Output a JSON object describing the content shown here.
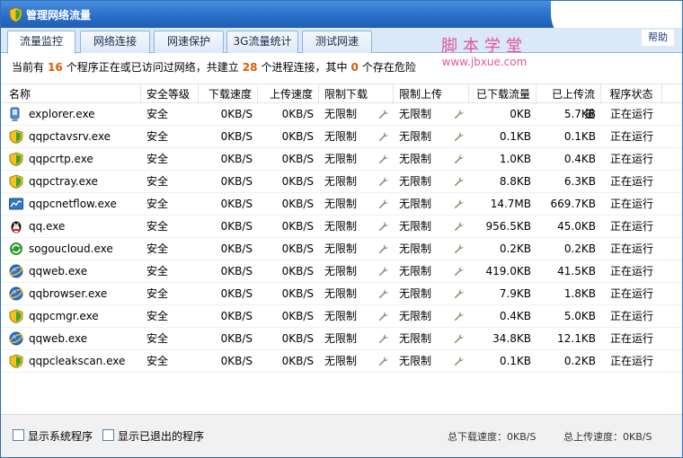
{
  "window": {
    "title": "管理网络流量"
  },
  "help_label": "帮助",
  "watermark": {
    "cn": "脚本学堂",
    "url": "www.jbxue.com"
  },
  "tabs": [
    {
      "label": "流量监控",
      "active": true
    },
    {
      "label": "网络连接",
      "active": false
    },
    {
      "label": "网速保护",
      "active": false
    },
    {
      "label": "3G流量统计",
      "active": false
    },
    {
      "label": "测试网速",
      "active": false
    }
  ],
  "summary": {
    "prefix": "当前有",
    "programs": "16",
    "mid1": "个程序正在或已访问过网络，共建立",
    "connections": "28",
    "mid2": "个进程连接，其中",
    "dangerous": "0",
    "suffix": "个存在危险"
  },
  "columns": [
    "名称",
    "安全等级",
    "下载速度",
    "上传速度",
    "限制下载",
    "限制上传",
    "已下载流量",
    "已上传流量",
    "程序状态"
  ],
  "rows": [
    {
      "icon": "ie-icon",
      "name": "explorer.exe",
      "safety": "安全",
      "down_speed": "0KB/S",
      "up_speed": "0KB/S",
      "limit_down": "无限制",
      "limit_up": "无限制",
      "downloaded": "0KB",
      "uploaded": "5.7KB",
      "status": "正在运行"
    },
    {
      "icon": "shield-icon",
      "name": "qqpctavsrv.exe",
      "safety": "安全",
      "down_speed": "0KB/S",
      "up_speed": "0KB/S",
      "limit_down": "无限制",
      "limit_up": "无限制",
      "downloaded": "0.1KB",
      "uploaded": "0.1KB",
      "status": "正在运行"
    },
    {
      "icon": "shield-icon",
      "name": "qqpcrtp.exe",
      "safety": "安全",
      "down_speed": "0KB/S",
      "up_speed": "0KB/S",
      "limit_down": "无限制",
      "limit_up": "无限制",
      "downloaded": "1.0KB",
      "uploaded": "0.4KB",
      "status": "正在运行"
    },
    {
      "icon": "shield-icon",
      "name": "qqpctray.exe",
      "safety": "安全",
      "down_speed": "0KB/S",
      "up_speed": "0KB/S",
      "limit_down": "无限制",
      "limit_up": "无限制",
      "downloaded": "8.8KB",
      "uploaded": "6.3KB",
      "status": "正在运行"
    },
    {
      "icon": "netflow-icon",
      "name": "qqpcnetflow.exe",
      "safety": "安全",
      "down_speed": "0KB/S",
      "up_speed": "0KB/S",
      "limit_down": "无限制",
      "limit_up": "无限制",
      "downloaded": "14.7MB",
      "uploaded": "669.7KB",
      "status": "正在运行"
    },
    {
      "icon": "penguin-icon",
      "name": "qq.exe",
      "safety": "安全",
      "down_speed": "0KB/S",
      "up_speed": "0KB/S",
      "limit_down": "无限制",
      "limit_up": "无限制",
      "downloaded": "956.5KB",
      "uploaded": "45.0KB",
      "status": "正在运行"
    },
    {
      "icon": "sync-icon",
      "name": "sogoucloud.exe",
      "safety": "安全",
      "down_speed": "0KB/S",
      "up_speed": "0KB/S",
      "limit_down": "无限制",
      "limit_up": "无限制",
      "downloaded": "0.2KB",
      "uploaded": "0.2KB",
      "status": "正在运行"
    },
    {
      "icon": "browser-icon",
      "name": "qqweb.exe",
      "safety": "安全",
      "down_speed": "0KB/S",
      "up_speed": "0KB/S",
      "limit_down": "无限制",
      "limit_up": "无限制",
      "downloaded": "419.0KB",
      "uploaded": "41.5KB",
      "status": "正在运行"
    },
    {
      "icon": "browser-icon",
      "name": "qqbrowser.exe",
      "safety": "安全",
      "down_speed": "0KB/S",
      "up_speed": "0KB/S",
      "limit_down": "无限制",
      "limit_up": "无限制",
      "downloaded": "7.9KB",
      "uploaded": "1.8KB",
      "status": "正在运行"
    },
    {
      "icon": "shield-icon",
      "name": "qqpcmgr.exe",
      "safety": "安全",
      "down_speed": "0KB/S",
      "up_speed": "0KB/S",
      "limit_down": "无限制",
      "limit_up": "无限制",
      "downloaded": "0.4KB",
      "uploaded": "5.0KB",
      "status": "正在运行"
    },
    {
      "icon": "browser-icon",
      "name": "qqweb.exe",
      "safety": "安全",
      "down_speed": "0KB/S",
      "up_speed": "0KB/S",
      "limit_down": "无限制",
      "limit_up": "无限制",
      "downloaded": "34.8KB",
      "uploaded": "12.1KB",
      "status": "正在运行"
    },
    {
      "icon": "shield-icon",
      "name": "qqpcleakscan.exe",
      "safety": "安全",
      "down_speed": "0KB/S",
      "up_speed": "0KB/S",
      "limit_down": "无限制",
      "limit_up": "无限制",
      "downloaded": "0.1KB",
      "uploaded": "0.2KB",
      "status": "正在运行"
    }
  ],
  "footer": {
    "show_system": "显示系统程序",
    "show_exited": "显示已退出的程序",
    "total_down": "总下载速度：0KB/S",
    "total_up": "总上传速度：0KB/S"
  },
  "colors": {
    "titlebar": "#2a6fc9",
    "highlight_number": "#e05a00",
    "watermark": "#e0569a"
  }
}
